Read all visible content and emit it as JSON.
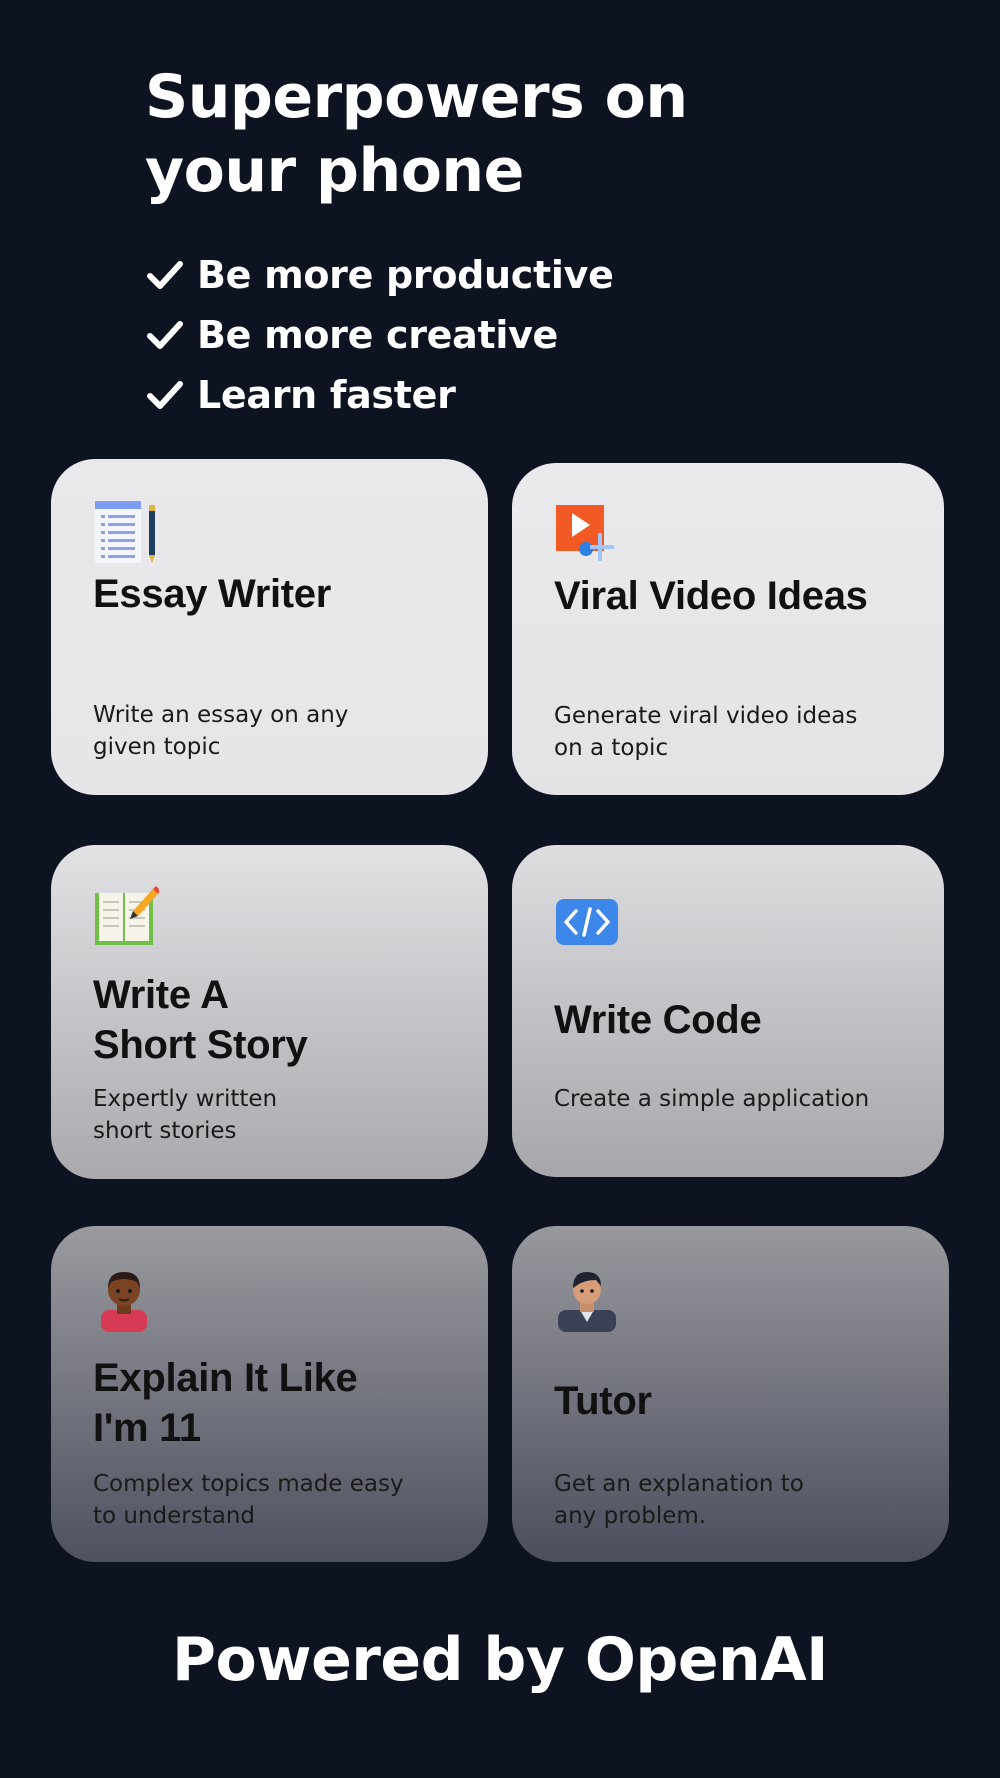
{
  "headline": {
    "line1": "Superpowers on",
    "line2": "your phone"
  },
  "features": [
    "Be more productive",
    "Be more creative",
    "Learn faster"
  ],
  "cards": [
    {
      "title_lines": [
        "Essay Writer"
      ],
      "desc_lines": [
        "Write an essay on any",
        "given topic"
      ],
      "icon": "document-pen-icon"
    },
    {
      "title_lines": [
        "Viral Video Ideas"
      ],
      "desc_lines": [
        "Generate viral video ideas",
        "on a topic"
      ],
      "icon": "video-play-icon"
    },
    {
      "title_lines": [
        "Write A",
        "Short Story"
      ],
      "desc_lines": [
        "Expertly written",
        "short stories"
      ],
      "icon": "open-book-pencil-icon"
    },
    {
      "title_lines": [
        "Write Code"
      ],
      "desc_lines": [
        "Create a simple application"
      ],
      "icon": "code-brackets-icon"
    },
    {
      "title_lines": [
        "Explain It Like",
        "I'm 11"
      ],
      "desc_lines": [
        "Complex topics made easy",
        "to understand"
      ],
      "icon": "child-avatar-icon"
    },
    {
      "title_lines": [
        "Tutor"
      ],
      "desc_lines": [
        "Get an explanation to",
        "any problem."
      ],
      "icon": "teacher-avatar-icon"
    }
  ],
  "footer": "Powered by OpenAI",
  "colors": {
    "background": "#0e1322",
    "text": "#ffffff",
    "card": "#e9e9eb"
  }
}
